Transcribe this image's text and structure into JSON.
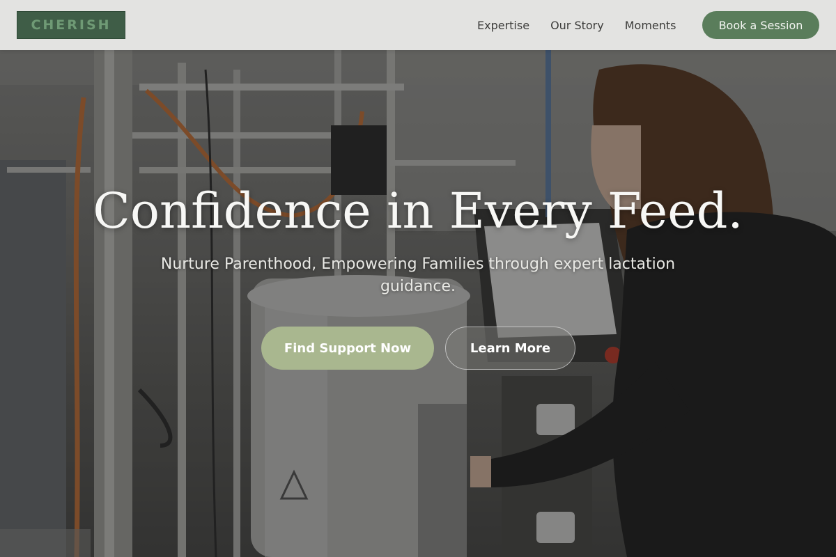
{
  "brand": {
    "name": "CHERISH"
  },
  "nav": {
    "links": [
      {
        "label": "Expertise"
      },
      {
        "label": "Our Story"
      },
      {
        "label": "Moments"
      }
    ],
    "cta_label": "Book a Session"
  },
  "hero": {
    "title": "Confidence in Every Feed.",
    "subtitle": "Nurture Parenthood, Empowering Families through expert lactation guidance.",
    "primary_button": "Find Support Now",
    "secondary_button": "Learn More",
    "background_image_icon": "lab-equipment-photo"
  },
  "colors": {
    "brand_green": "#5a7d5b",
    "logo_bg": "#3f5d47",
    "primary_button": "#a9b78f",
    "nav_bg": "#ecece a"
  }
}
